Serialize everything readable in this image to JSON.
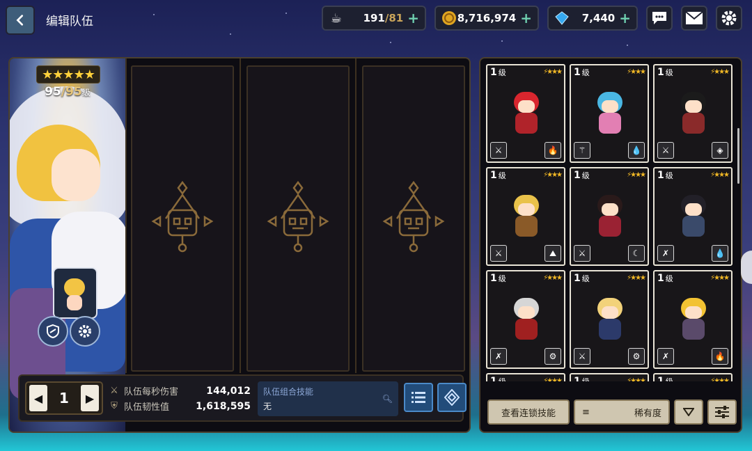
{
  "header": {
    "title": "编辑队伍",
    "coffee": {
      "current": "191",
      "max": "/81"
    },
    "gold": "8,716,974",
    "gems": "7,440",
    "icons": [
      "coffee-icon",
      "coin-icon",
      "gem-icon",
      "chat-icon",
      "mail-icon",
      "settings-icon"
    ]
  },
  "hero": {
    "stars": "★★★★★",
    "level_current": "95",
    "level_max": "/95",
    "level_unit": "级"
  },
  "team": {
    "number": "1",
    "dps_label": "队伍每秒伤害",
    "dps_value": "144,012",
    "toughness_label": "队伍韧性值",
    "toughness_value": "1,618,595",
    "combo_title": "队伍组合技能",
    "combo_value": "无"
  },
  "roster": {
    "level_unit": "级",
    "cards": [
      {
        "level": "1",
        "hair": "#d8262e",
        "body": "#b0232a",
        "left_icon": "⚔",
        "right_icon": "🔥"
      },
      {
        "level": "1",
        "hair": "#4ab7e3",
        "body": "#e27fb3",
        "left_icon": "⚚",
        "right_icon": "💧"
      },
      {
        "level": "1",
        "hair": "#1b1b1b",
        "body": "#8a2a2a",
        "left_icon": "⚔",
        "right_icon": "◈"
      },
      {
        "level": "1",
        "hair": "#e9c24a",
        "body": "#8a5a28",
        "left_icon": "⚔",
        "right_icon": "⛰"
      },
      {
        "level": "1",
        "hair": "#2a1a1a",
        "body": "#9a2233",
        "left_icon": "⚔",
        "right_icon": "☾"
      },
      {
        "level": "1",
        "hair": "#222028",
        "body": "#3a4a6a",
        "left_icon": "✗",
        "right_icon": "💧"
      },
      {
        "level": "1",
        "hair": "#d6d6d6",
        "body": "#a02020",
        "left_icon": "✗",
        "right_icon": "⚙"
      },
      {
        "level": "1",
        "hair": "#f2d27a",
        "body": "#2c3a6a",
        "left_icon": "⚔",
        "right_icon": "⚙"
      },
      {
        "level": "1",
        "hair": "#f2c232",
        "body": "#5a4a6a",
        "left_icon": "✗",
        "right_icon": "🔥"
      },
      {
        "level": "1",
        "hair": "#444",
        "body": "#333",
        "left_icon": "",
        "right_icon": ""
      },
      {
        "level": "1",
        "hair": "#444",
        "body": "#333",
        "left_icon": "",
        "right_icon": ""
      },
      {
        "level": "1",
        "hair": "#444",
        "body": "#333",
        "left_icon": "",
        "right_icon": ""
      }
    ],
    "chain_skill_button": "查看连锁技能",
    "sort_label": "稀有度"
  },
  "colors": {
    "accent_gold": "#c9a45a",
    "plus_green": "#6fd0b0",
    "star_yellow": "#ffd13b",
    "button_blue": "#224c7a"
  }
}
